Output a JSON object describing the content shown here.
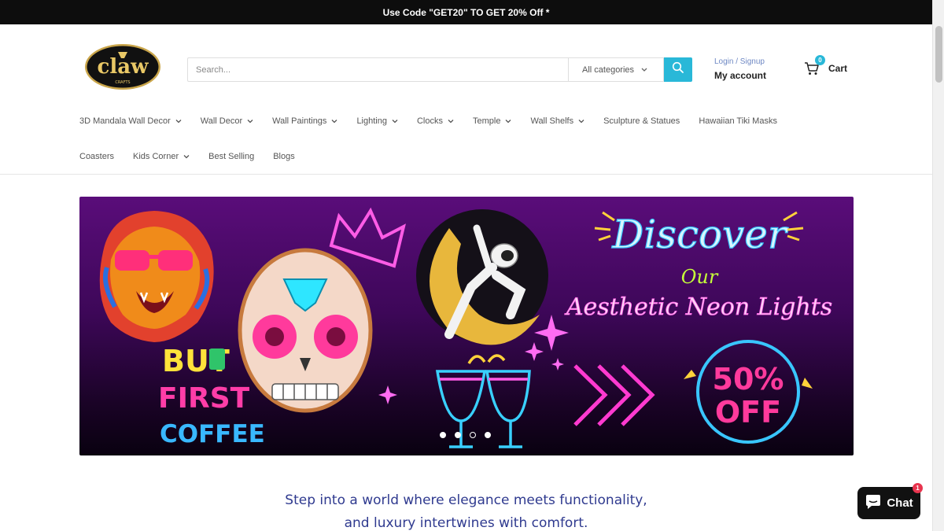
{
  "announcement": "Use Code \"GET20\" TO GET 20% Off *",
  "logo": {
    "text": "claw",
    "subtext": "CRAFTS"
  },
  "search": {
    "placeholder": "Search...",
    "category": "All categories",
    "icon": "search-icon"
  },
  "account": {
    "login_label": "Login / Signup",
    "account_label": "My account"
  },
  "cart": {
    "count": "0",
    "label": "Cart",
    "icon": "cart-icon"
  },
  "nav": {
    "row1": [
      {
        "label": "3D Mandala Wall Decor",
        "dropdown": true
      },
      {
        "label": "Wall Decor",
        "dropdown": true
      },
      {
        "label": "Wall Paintings",
        "dropdown": true
      },
      {
        "label": "Lighting",
        "dropdown": true
      },
      {
        "label": "Clocks",
        "dropdown": true
      },
      {
        "label": "Temple",
        "dropdown": true
      },
      {
        "label": "Wall Shelfs",
        "dropdown": true
      },
      {
        "label": "Sculpture & Statues",
        "dropdown": false
      },
      {
        "label": "Hawaiian Tiki Masks",
        "dropdown": false
      }
    ],
    "row2": [
      {
        "label": "Coasters",
        "dropdown": false
      },
      {
        "label": "Kids Corner",
        "dropdown": true
      },
      {
        "label": "Best Selling",
        "dropdown": false
      },
      {
        "label": "Blogs",
        "dropdown": false
      }
    ]
  },
  "banner": {
    "headline": "Discover",
    "sub1": "Our",
    "sub2": "Aesthetic Neon Lights",
    "coffee": [
      "BUT",
      "FIRST",
      "COFFEE"
    ],
    "discount_value": "50%",
    "discount_word": "OFF",
    "slides_total": 4,
    "active_slide": 2
  },
  "tagline": {
    "line1": "Step into a world where elegance meets functionality,",
    "line2": "and luxury intertwines with comfort."
  },
  "chat": {
    "label": "Chat",
    "badge": "1",
    "icon": "chat-bubble-icon"
  },
  "colors": {
    "accent": "#29b8d8",
    "announce_bg": "#0d0d0d",
    "tagline": "#2f3a8f",
    "chat_badge": "#e8344e"
  }
}
